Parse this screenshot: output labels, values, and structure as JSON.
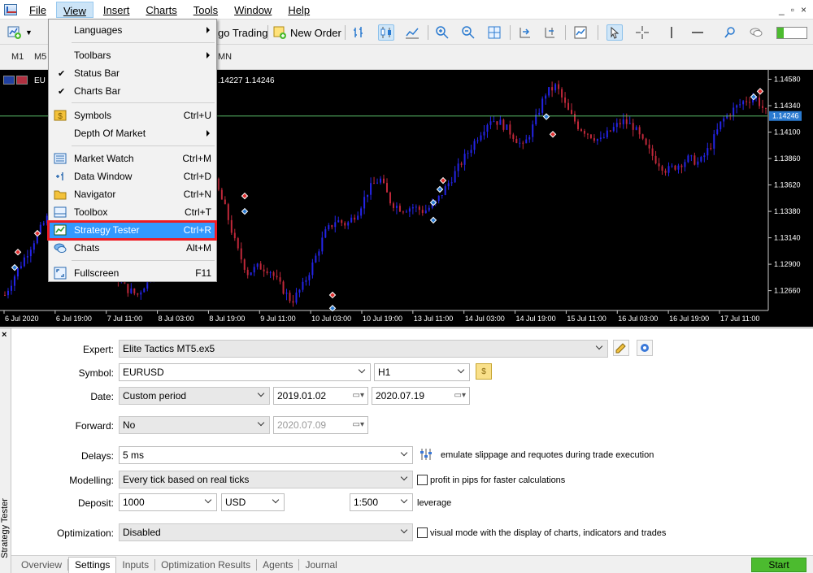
{
  "menubar": {
    "items": [
      "File",
      "View",
      "Insert",
      "Charts",
      "Tools",
      "Window",
      "Help"
    ],
    "window_controls": [
      "_",
      "▫",
      "×"
    ]
  },
  "toolbar": {
    "algo_trading_label": "go Trading",
    "new_order_label": "New Order"
  },
  "timeframes": [
    "M1",
    "M5",
    "MN"
  ],
  "view_menu": {
    "items": [
      {
        "label": "Languages",
        "shortcut": "",
        "submenu": true
      },
      {
        "label": "Toolbars",
        "shortcut": "",
        "submenu": true
      },
      {
        "label": "Status Bar",
        "shortcut": "",
        "checked": true
      },
      {
        "label": "Charts Bar",
        "shortcut": "",
        "checked": true
      },
      {
        "label": "Symbols",
        "shortcut": "Ctrl+U"
      },
      {
        "label": "Depth Of Market",
        "shortcut": "",
        "submenu": true
      },
      {
        "label": "Market Watch",
        "shortcut": "Ctrl+M"
      },
      {
        "label": "Data Window",
        "shortcut": "Ctrl+D"
      },
      {
        "label": "Navigator",
        "shortcut": "Ctrl+N"
      },
      {
        "label": "Toolbox",
        "shortcut": "Ctrl+T"
      },
      {
        "label": "Strategy Tester",
        "shortcut": "Ctrl+R",
        "highlighted": true
      },
      {
        "label": "Chats",
        "shortcut": "Alt+M"
      },
      {
        "label": "Fullscreen",
        "shortcut": "F11"
      }
    ]
  },
  "chart": {
    "symbol_label": "EU",
    "quote_text": ".14227 1.14246",
    "current_price_label": "1.14246"
  },
  "chart_data": {
    "type": "candlestick",
    "title": "",
    "symbol": "EURUSD",
    "x_tick_labels": [
      "6 Jul 2020",
      "6 Jul 19:00",
      "7 Jul 11:00",
      "8 Jul 03:00",
      "8 Jul 19:00",
      "9 Jul 11:00",
      "10 Jul 03:00",
      "10 Jul 19:00",
      "13 Jul 11:00",
      "14 Jul 03:00",
      "14 Jul 19:00",
      "15 Jul 11:00",
      "16 Jul 03:00",
      "16 Jul 19:00",
      "17 Jul 11:00"
    ],
    "y_tick_labels": [
      "1.14580",
      "1.14340",
      "1.14100",
      "1.13860",
      "1.13620",
      "1.13380",
      "1.13140",
      "1.12900",
      "1.12660"
    ],
    "ylim": [
      1.1248,
      1.1465
    ],
    "price_line": 1.14246,
    "close_path": [
      1.1262,
      1.1282,
      1.13,
      1.1318,
      1.1335,
      1.134,
      1.133,
      1.1312,
      1.1296,
      1.129,
      1.128,
      1.1268,
      1.1262,
      1.1276,
      1.1292,
      1.1308,
      1.1325,
      1.1338,
      1.1345,
      1.1366,
      1.134,
      1.1305,
      1.1282,
      1.1288,
      1.1285,
      1.127,
      1.1256,
      1.127,
      1.1292,
      1.1318,
      1.133,
      1.1326,
      1.1338,
      1.1358,
      1.1368,
      1.1346,
      1.134,
      1.1342,
      1.1338,
      1.1345,
      1.136,
      1.1376,
      1.1392,
      1.1408,
      1.1422,
      1.1418,
      1.1408,
      1.1396,
      1.1418,
      1.1445,
      1.1452,
      1.143,
      1.1415,
      1.1408,
      1.1402,
      1.1412,
      1.142,
      1.1415,
      1.1398,
      1.1385,
      1.1375,
      1.138,
      1.1386,
      1.1382,
      1.1398,
      1.142,
      1.143,
      1.1438,
      1.1442,
      1.1428
    ]
  },
  "tester": {
    "side_title": "Strategy Tester",
    "close_glyph": "×",
    "labels": {
      "expert": "Expert:",
      "symbol": "Symbol:",
      "date": "Date:",
      "forward": "Forward:",
      "delays": "Delays:",
      "modelling": "Modelling:",
      "deposit": "Deposit:",
      "optimization": "Optimization:"
    },
    "expert_value": "Elite Tactics MT5.ex5",
    "symbol_value": "EURUSD",
    "period_value": "H1",
    "date_mode": "Custom period",
    "date_from": "2019.01.02",
    "date_to": "2020.07.19",
    "forward_value": "No",
    "forward_date": "2020.07.09",
    "delays_value": "5 ms",
    "delays_note": "emulate slippage and requotes during trade execution",
    "modelling_value": "Every tick based on real ticks",
    "pips_note": "profit in pips for faster calculations",
    "deposit_value": "1000",
    "currency_value": "USD",
    "leverage_value": "1:500",
    "leverage_label": "leverage",
    "optimization_value": "Disabled",
    "visual_note": "visual mode with the display of charts, indicators and trades"
  },
  "tabs": [
    "Overview",
    "Settings",
    "Inputs",
    "Optimization Results",
    "Agents",
    "Journal"
  ],
  "start_label": "Start",
  "colors": {
    "highlight": "#3399ff",
    "red_box": "#ee1c24",
    "bull": "#2424e8",
    "bear": "#c0283a",
    "price_line": "#5cc06a",
    "start": "#4cbb2f"
  }
}
